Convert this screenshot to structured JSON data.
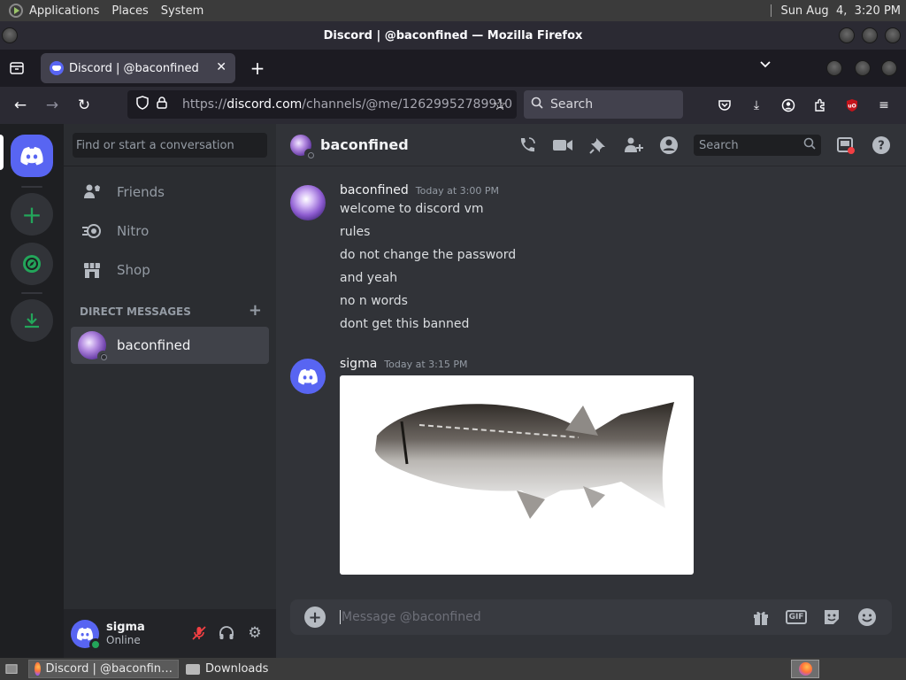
{
  "os_panel": {
    "menus": [
      "Applications",
      "Places",
      "System"
    ],
    "clock": "Sun Aug  4,  3:20 PM"
  },
  "browser": {
    "window_title": "Discord | @baconfined — Mozilla Firefox",
    "tab": {
      "title": "Discord | @baconfined",
      "favicon": "discord-icon"
    },
    "url": {
      "scheme": "https://",
      "host": "discord.com",
      "path": "/channels/@me/12629952789910"
    },
    "search_placeholder": "Search"
  },
  "discord": {
    "dm_search_placeholder": "Find or start a conversation",
    "nav": [
      {
        "label": "Friends",
        "icon": "friends-icon"
      },
      {
        "label": "Nitro",
        "icon": "nitro-icon"
      },
      {
        "label": "Shop",
        "icon": "shop-icon"
      }
    ],
    "dm_header": "DIRECT MESSAGES",
    "dms": [
      {
        "name": "baconfined",
        "status": "offline"
      }
    ],
    "user": {
      "name": "sigma",
      "status": "Online"
    },
    "chat": {
      "title": "baconfined",
      "header_search_placeholder": "Search",
      "messages": [
        {
          "author": "baconfined",
          "time": "Today at 3:00 PM",
          "lines": [
            "welcome to discord vm",
            "rules",
            "do not change the password",
            "and yeah",
            "no n words",
            "dont get this banned"
          ]
        },
        {
          "author": "sigma",
          "time": "Today at 3:15 PM",
          "attachment": "fish image"
        }
      ],
      "composer_placeholder": "Message @baconfined"
    },
    "colors": {
      "blurple": "#5865f2",
      "online": "#23a55a",
      "muted_red": "#f23f43"
    }
  },
  "taskbar": {
    "tasks": [
      {
        "label": "Discord | @baconfin…",
        "icon": "firefox-icon"
      },
      {
        "label": "Downloads",
        "icon": "folder-icon"
      }
    ]
  }
}
